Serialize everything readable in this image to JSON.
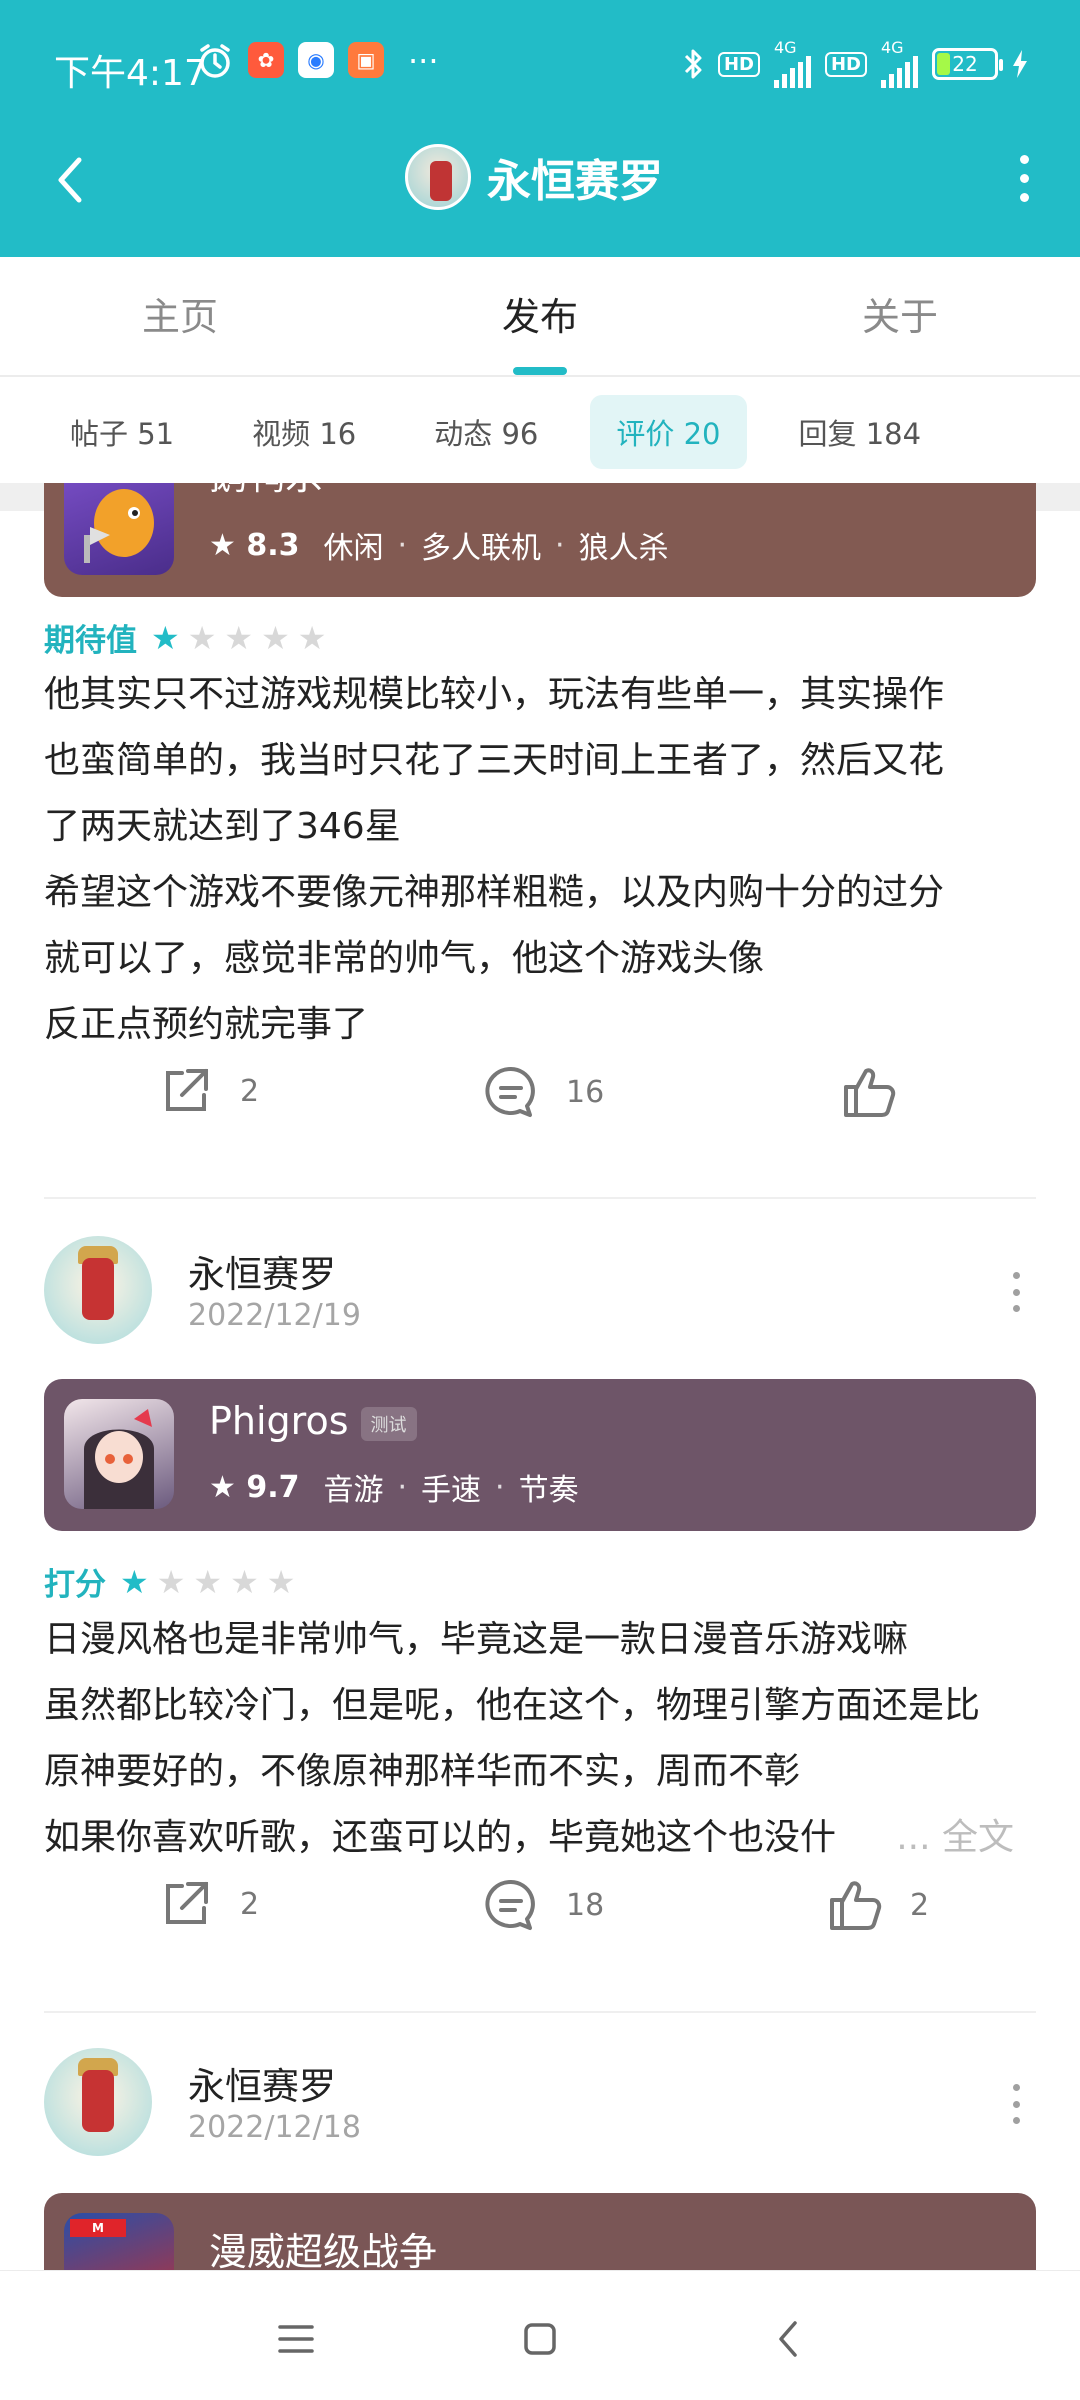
{
  "status_bar": {
    "time": "下午4:17",
    "network_1": "4G",
    "network_2": "4G",
    "hd_1": "HD",
    "hd_2": "HD",
    "battery": "22",
    "more": "···"
  },
  "nav": {
    "title": "永恒赛罗",
    "accent_color": "#22bcc7"
  },
  "main_tabs": [
    {
      "label": "主页",
      "active": false
    },
    {
      "label": "发布",
      "active": true
    },
    {
      "label": "关于",
      "active": false
    }
  ],
  "sub_tabs": [
    {
      "label": "帖子 51"
    },
    {
      "label": "视频 16"
    },
    {
      "label": "动态 96"
    },
    {
      "label": "评价 20",
      "active": true
    },
    {
      "label": "回复 184"
    }
  ],
  "reviews": [
    {
      "game": {
        "name": "鹅鸭杀",
        "score": "8.3",
        "tags": [
          "休闲",
          "多人联机",
          "狼人杀"
        ],
        "card_color": "#825a52"
      },
      "rating_label": "期待值",
      "stars": 1,
      "text": [
        "他其实只不过游戏规模比较小，玩法有些单一，其实操作",
        "也蛮简单的，我当时只花了三天时间上王者了，然后又花",
        "了两天就达到了346星",
        "希望这个游戏不要像元神那样粗糙，以及内购十分的过分",
        "就可以了，感觉非常的帅气，他这个游戏头像",
        "反正点预约就完事了"
      ],
      "shares": "2",
      "comments": "16",
      "likes": ""
    },
    {
      "author": "永恒赛罗",
      "date": "2022/12/19",
      "game": {
        "name": "Phigros",
        "badge": "测试",
        "score": "9.7",
        "tags": [
          "音游",
          "手速",
          "节奏"
        ],
        "card_color": "#6e5568"
      },
      "rating_label": "打分",
      "stars": 1,
      "text": [
        "日漫风格也是非常帅气，毕竟这是一款日漫音乐游戏嘛",
        "虽然都比较冷门，但是呢，他在这个，物理引擎方面还是比",
        "原神要好的，不像原神那样华而不实，周而不彰",
        "如果你喜欢听歌，还蛮可以的，毕竟她这个也没什"
      ],
      "more_label": "... 全文",
      "shares": "2",
      "comments": "18",
      "likes": "2"
    },
    {
      "author": "永恒赛罗",
      "date": "2022/12/18",
      "game": {
        "name": "漫威超级战争",
        "card_color": "#7a5656"
      }
    }
  ]
}
